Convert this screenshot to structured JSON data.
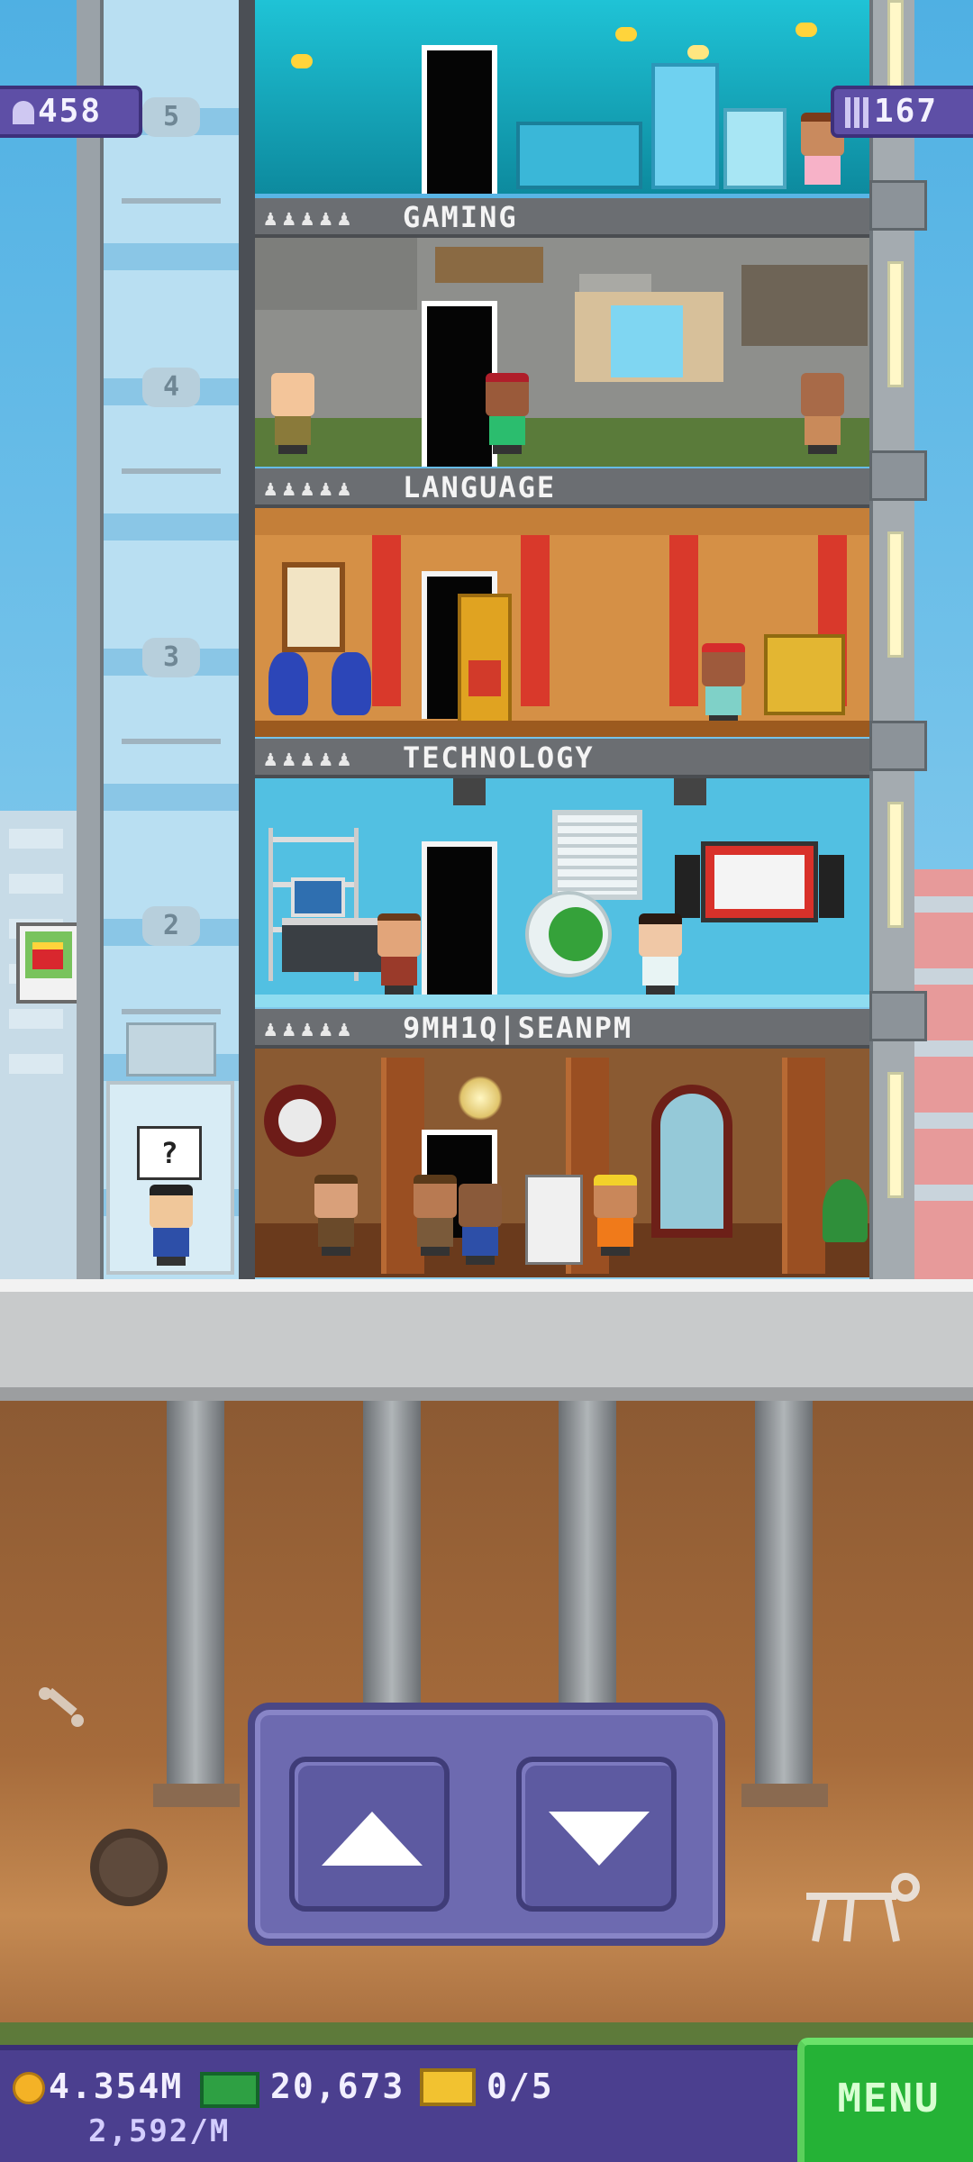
{
  "hud": {
    "population": "458",
    "floors": "167",
    "population_icon": "person-icon",
    "floors_icon": "building-icon"
  },
  "floors": [
    {
      "id": "aquarium",
      "name": "",
      "stars": ""
    },
    {
      "id": "gaming",
      "name": "GAMING",
      "stars": "♟♟♟♟♟",
      "level": 5
    },
    {
      "id": "language",
      "name": "LANGUAGE",
      "stars": "♟♟♟♟♟",
      "level": 5
    },
    {
      "id": "technology",
      "name": "TECHNOLOGY",
      "stars": "♟♟♟♟♟",
      "level": 5
    },
    {
      "id": "lobby",
      "name": "9MH1Q|SEANPM",
      "stars": "♟♟♟♟♟",
      "level": 4
    }
  ],
  "elevator": {
    "floor_markers": [
      "5",
      "4",
      "3",
      "2"
    ],
    "rider_bubble": "?",
    "up_icon": "arrow-up-icon",
    "down_icon": "arrow-down-icon"
  },
  "bottom_bar": {
    "coins": "4.354M",
    "coin_rate": "2,592/M",
    "bux": "20,673",
    "tickets": "0/5",
    "menu_label": "MENU"
  },
  "colors": {
    "hud_purple": "#5e4fa6",
    "menu_green": "#25b236",
    "sky": "#5fb6e4",
    "coin": "#f4b226"
  }
}
